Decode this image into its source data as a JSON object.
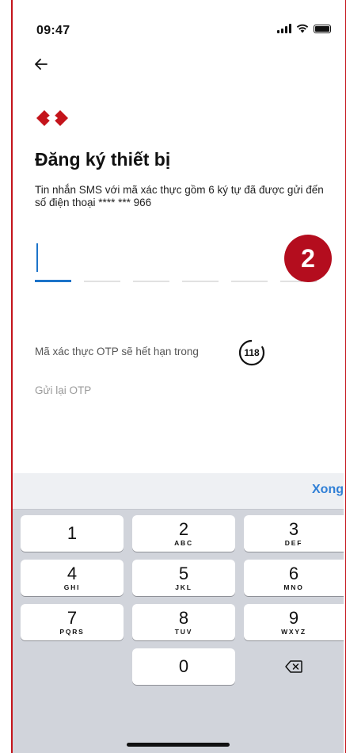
{
  "status": {
    "time": "09:47"
  },
  "header": {
    "back_icon": "back-arrow-icon"
  },
  "brand": {
    "logo_icon": "bank-logo-icon",
    "color": "#c4141b"
  },
  "content": {
    "title": "Đăng ký thiết bị",
    "description": "Tin nhắn SMS với mã xác thực gồm 6 ký tự đã được gửi đến số điện thoại **** *** 966",
    "otp_length": 6,
    "otp_value": "",
    "step_badge": "2",
    "timer_label": "Mã xác thực OTP sẽ hết hạn trong",
    "timer_value": "118",
    "resend_label": "Gửi lại OTP"
  },
  "keyboard": {
    "done_label": "Xong",
    "keys": [
      {
        "digit": "1",
        "letters": ""
      },
      {
        "digit": "2",
        "letters": "ABC"
      },
      {
        "digit": "3",
        "letters": "DEF"
      },
      {
        "digit": "4",
        "letters": "GHI"
      },
      {
        "digit": "5",
        "letters": "JKL"
      },
      {
        "digit": "6",
        "letters": "MNO"
      },
      {
        "digit": "7",
        "letters": "PQRS"
      },
      {
        "digit": "8",
        "letters": "TUV"
      },
      {
        "digit": "9",
        "letters": "WXYZ"
      },
      {
        "digit": "0",
        "letters": ""
      }
    ],
    "backspace_icon": "backspace-icon"
  },
  "colors": {
    "accent": "#1c73c9",
    "badge": "#b40d1e",
    "link": "#2f7fd6"
  }
}
